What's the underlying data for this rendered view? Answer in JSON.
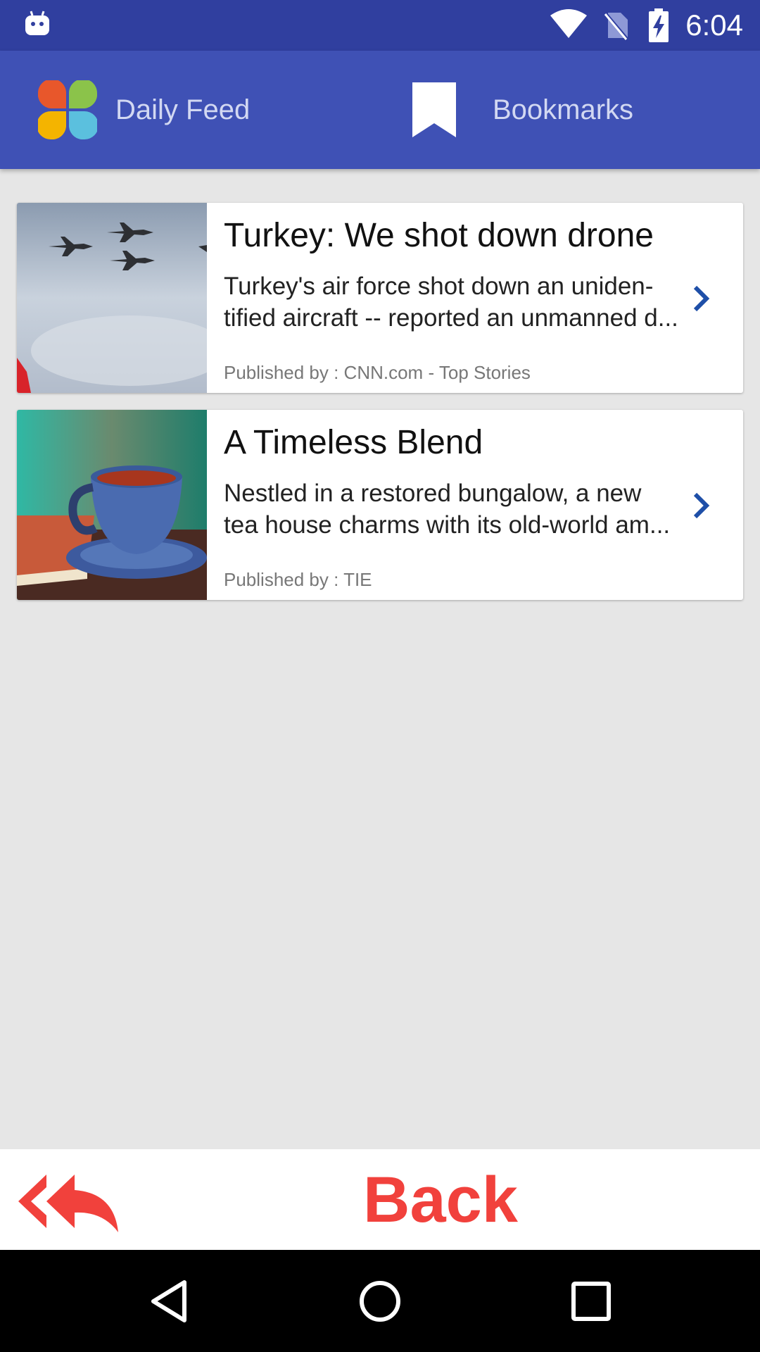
{
  "status_bar": {
    "time": "6:04",
    "icons": [
      "android-robot-icon",
      "wifi-icon",
      "no-sim-icon",
      "battery-charging-icon"
    ]
  },
  "app_bar": {
    "tabs": [
      {
        "label": "Daily Feed",
        "icon": "petal-logo-icon"
      },
      {
        "label": "Bookmarks",
        "icon": "bookmark-icon"
      }
    ],
    "logo_colors": [
      "#e8572b",
      "#8bc34a",
      "#f4b400",
      "#5bc0de"
    ]
  },
  "articles": [
    {
      "title": "Turkey: We shot down drone",
      "summary_line1": "Turkey's air force shot down an uniden-",
      "summary_line2": "tified aircraft -- reported an unmanned d...",
      "publisher": "Published by : CNN.com - Top Stories",
      "thumbnail": "fighter-jets-photo"
    },
    {
      "title": "A Timeless Blend",
      "summary_line1": "Nestled in a restored bungalow, a new",
      "summary_line2": "tea house charms with its old-world am...",
      "publisher": "Published by : TIE",
      "thumbnail": "tea-cup-photo"
    }
  ],
  "back_bar": {
    "label": "Back",
    "icon": "reply-all-icon",
    "color": "#f1413c"
  },
  "nav_bar": {
    "buttons": [
      "nav-back-icon",
      "nav-home-icon",
      "nav-recent-icon"
    ]
  },
  "colors": {
    "status_bar": "#303f9f",
    "app_bar": "#3f51b5",
    "chevron": "#1e4fa8",
    "background": "#e6e6e6"
  }
}
